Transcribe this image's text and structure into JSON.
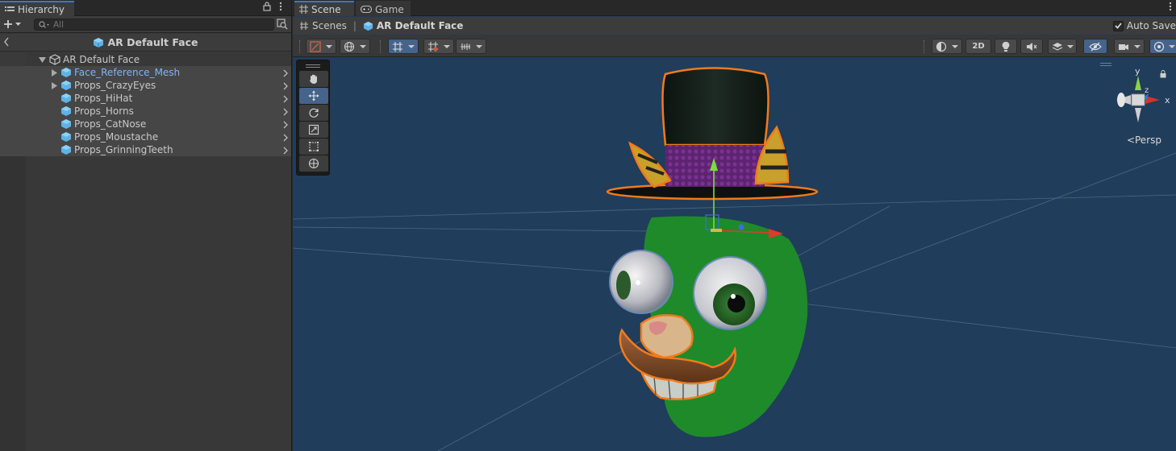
{
  "hierarchy": {
    "tab_label": "Hierarchy",
    "search_placeholder": "All",
    "scene_title": "AR Default Face",
    "root_item": "AR Default Face",
    "items": [
      {
        "label": "Face_Reference_Mesh",
        "selected": true,
        "expandable": true
      },
      {
        "label": "Props_CrazyEyes",
        "selected": false,
        "expandable": true
      },
      {
        "label": "Props_HiHat",
        "selected": false,
        "expandable": false
      },
      {
        "label": "Props_Horns",
        "selected": false,
        "expandable": false
      },
      {
        "label": "Props_CatNose",
        "selected": false,
        "expandable": false
      },
      {
        "label": "Props_Moustache",
        "selected": false,
        "expandable": false
      },
      {
        "label": "Props_GrinningTeeth",
        "selected": false,
        "expandable": false
      }
    ]
  },
  "scene": {
    "tabs": [
      {
        "label": "Scene",
        "icon": "grid-icon",
        "active": true
      },
      {
        "label": "Game",
        "icon": "gamepad-icon",
        "active": false
      }
    ],
    "breadcrumb": {
      "root": "Scenes",
      "current": "AR Default Face"
    },
    "auto_save_label": "Auto Save",
    "auto_save_checked": true,
    "toolbar": {
      "mode_2d_label": "2D"
    },
    "persp_label": "Persp",
    "axis_labels": {
      "x": "x",
      "y": "y",
      "z": "z"
    }
  },
  "colors": {
    "accent": "#3a79bb",
    "selected_text": "#7fb4f6",
    "viewport_bg": "#203d5b",
    "face_green": "#1f8a2a",
    "outline_orange": "#f27a1a",
    "hat_band": "#6a2a7e"
  }
}
